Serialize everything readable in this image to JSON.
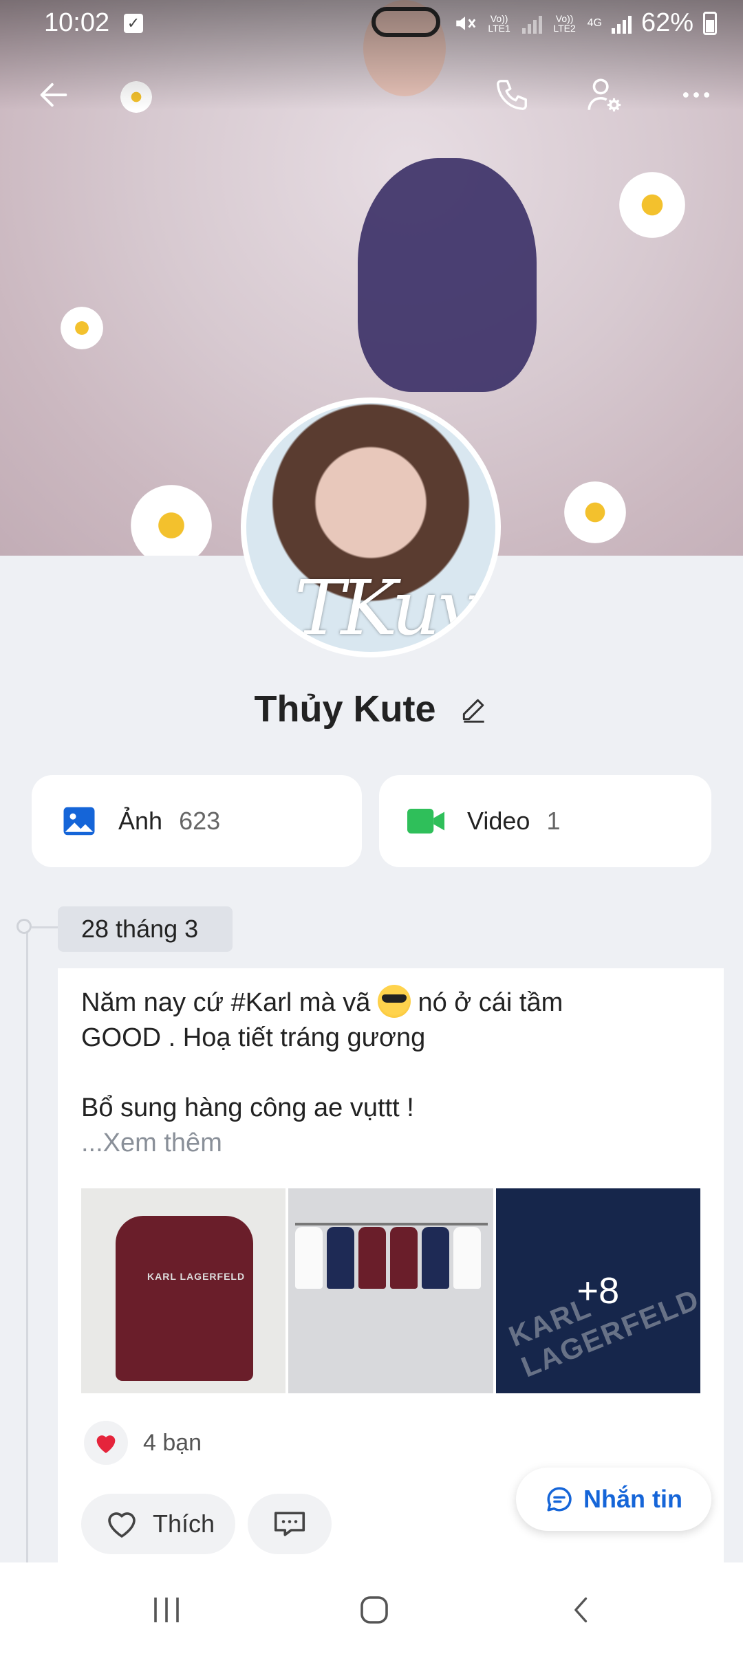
{
  "status_bar": {
    "time": "10:02",
    "battery": "62%",
    "sim1": "Vo)) LTE1",
    "sim2": "Vo)) LTE2",
    "network": "4G"
  },
  "top_actions": {
    "back_icon": "arrow-left-icon",
    "call_icon": "phone-icon",
    "settings_icon": "user-gear-icon",
    "more_icon": "more-horizontal-icon"
  },
  "profile": {
    "name": "Thủy Kute",
    "avatar_signature": "TKuy"
  },
  "media": [
    {
      "label": "Ảnh",
      "count": "623",
      "icon": "image-icon",
      "color": "#1565d8"
    },
    {
      "label": "Video",
      "count": "1",
      "icon": "video-icon",
      "color": "#2fbf5a"
    }
  ],
  "timeline": {
    "date": "28 tháng 3"
  },
  "post": {
    "line1_before": "Năm nay cứ #Karl mà vã",
    "line1_after": "nó ở cái tầm",
    "line2": "GOOD . Hoạ tiết tráng gương",
    "line3": "Bổ sung hàng công ae vụttt !",
    "see_more": "...Xem thêm",
    "photo1_text": "KARL LAGERFELD",
    "photo3_text": "KARL LAGERFELD",
    "more_photos": "+8",
    "reaction_count": "4 bạn",
    "like_label": "Thích"
  },
  "fab": {
    "label": "Nhắn tin"
  },
  "colors": {
    "accent": "#1565d8",
    "video_green": "#2fbf5a",
    "heart_red": "#e5243b"
  }
}
